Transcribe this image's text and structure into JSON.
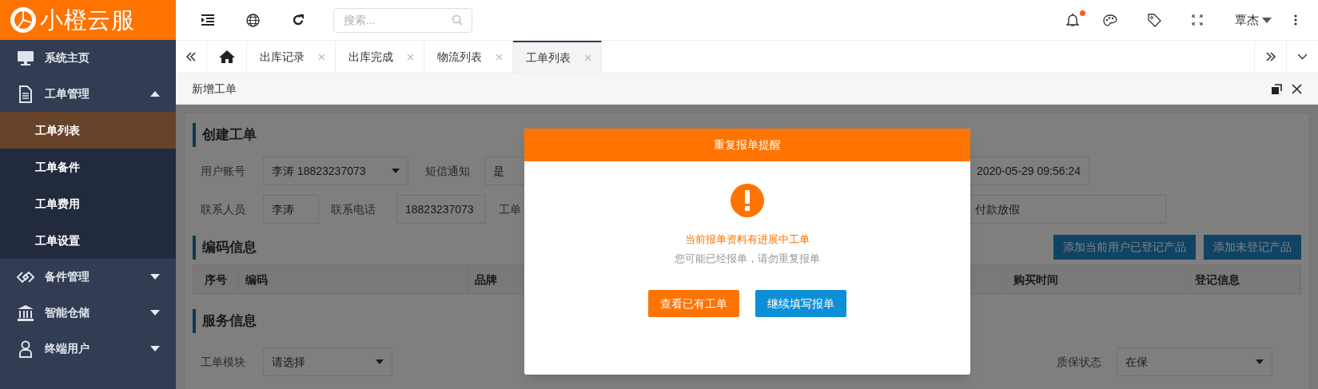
{
  "logo": {
    "text": "小橙云服"
  },
  "topbar": {
    "search": {
      "placeholder": "搜索..."
    },
    "notification_dot": true,
    "user": "覃杰"
  },
  "sidebar": {
    "items": [
      {
        "label": "系统主页",
        "kind": "monitor"
      },
      {
        "label": "工单管理",
        "kind": "document",
        "expanded": true,
        "children": [
          {
            "label": "工单列表",
            "selected": true
          },
          {
            "label": "工单备件",
            "selected": false
          },
          {
            "label": "工单费用",
            "selected": false
          },
          {
            "label": "工单设置",
            "selected": false
          }
        ]
      },
      {
        "label": "备件管理",
        "kind": "link",
        "expanded": false
      },
      {
        "label": "智能仓储",
        "kind": "bank",
        "expanded": false
      },
      {
        "label": "终端用户",
        "kind": "user",
        "expanded": false
      }
    ]
  },
  "tabs": [
    {
      "kind": "home",
      "selected": false
    },
    {
      "kind": "page",
      "label": "出库记录",
      "selected": false
    },
    {
      "kind": "page",
      "label": "出库完成",
      "selected": false
    },
    {
      "kind": "page",
      "label": "物流列表",
      "selected": false
    },
    {
      "kind": "page",
      "label": "工单列表",
      "selected": true
    }
  ],
  "page_title": "新增工单",
  "form": {
    "section_1": "创建工单",
    "user_account_label": "用户账号",
    "user_account": "李涛 18823237073",
    "sms_label": "短信通知",
    "sms": "是",
    "datetime": "2020-05-29 09:56:24",
    "contact_label": "联系人员",
    "contact": "李涛",
    "phone_label": "联系电话",
    "phone": "18823237073",
    "address_label": "工单",
    "address": "付款放假",
    "section_2": "编码信息",
    "buttons": [
      "添加当前用户已登记产品",
      "添加未登记产品"
    ],
    "table_columns": [
      "序号",
      "编码",
      "品牌",
      "购买时间",
      "登记信息"
    ],
    "section_3": "服务信息",
    "module_label": "工单模块",
    "module_placeholder": "请选择",
    "warranty_label": "质保状态",
    "warranty": "在保"
  },
  "dialog": {
    "title": "重复报单提醒",
    "message": "当前报单资料有进展中工单",
    "hint": "您可能已经报单，请勿重复报单",
    "buttons": [
      {
        "label": "查看已有工单",
        "kind": "primary"
      },
      {
        "label": "继续填写报单",
        "kind": "secondary"
      }
    ]
  }
}
